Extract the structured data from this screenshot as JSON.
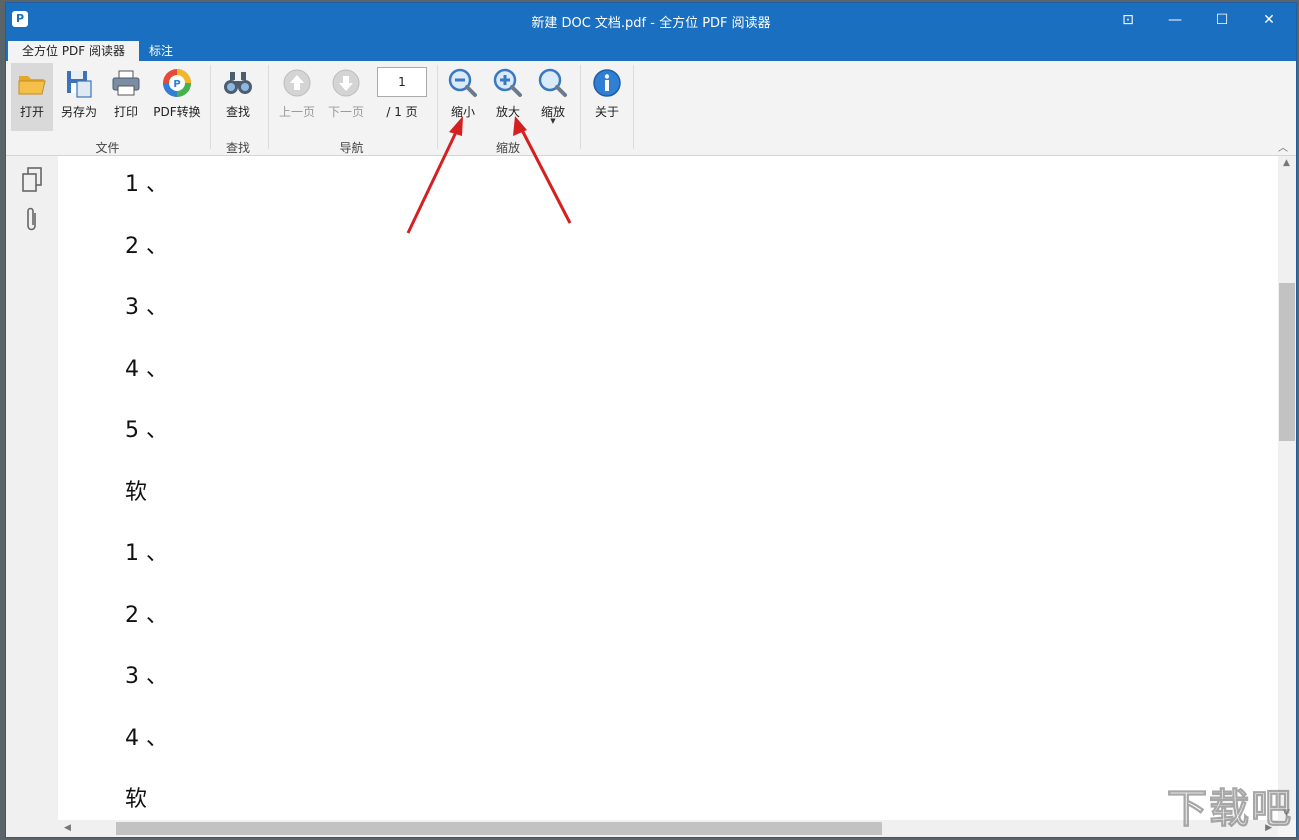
{
  "window": {
    "title": "新建 DOC 文档.pdf - 全方位 PDF 阅读器",
    "logo_letter": "P",
    "controls": {
      "pin": "⊡",
      "minimize": "—",
      "maximize": "☐",
      "close": "✕"
    }
  },
  "tabs": [
    {
      "label": "全方位 PDF 阅读器",
      "active": true
    },
    {
      "label": "标注",
      "active": false
    }
  ],
  "ribbon": {
    "file_group": {
      "label": "文件",
      "open": "打开",
      "save_as": "另存为",
      "print": "打印",
      "pdf_convert": "PDF转换"
    },
    "find_group": {
      "label": "查找",
      "find": "查找"
    },
    "nav_group": {
      "label": "导航",
      "prev_page": "上一页",
      "next_page": "下一页",
      "page_value": "1",
      "page_total": "/ 1 页"
    },
    "zoom_group": {
      "label": "缩放",
      "zoom_out": "缩小",
      "zoom_in": "放大",
      "zoom": "缩放"
    },
    "about": "关于"
  },
  "document": {
    "lines": [
      "1 、",
      "2 、",
      "3 、",
      "4 、",
      "5 、",
      "软",
      "1 、",
      "2 、",
      "3 、",
      "4 、",
      "软"
    ]
  },
  "colors": {
    "titlebar": "#1a6fc0",
    "annotation_arrow": "#d42020"
  },
  "watermark": "下载吧"
}
